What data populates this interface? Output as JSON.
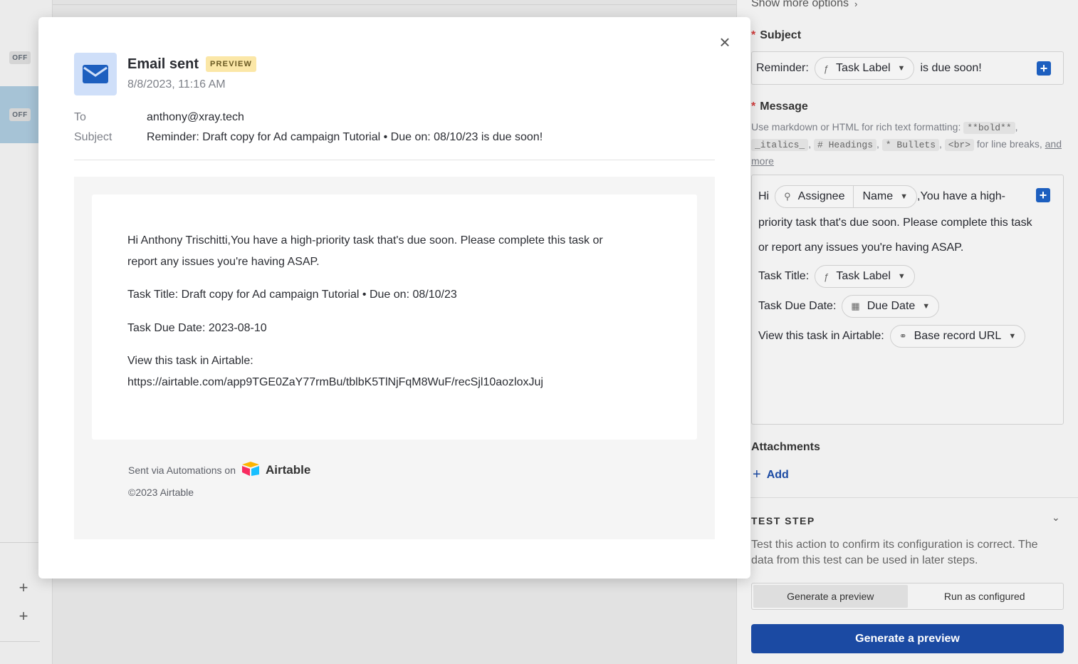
{
  "left_strip": {
    "off_label": "OFF",
    "plus_glyph": "+"
  },
  "modal": {
    "close_glyph": "×",
    "title": "Email sent",
    "badge": "PREVIEW",
    "timestamp": "8/8/2023, 11:16 AM",
    "to_label": "To",
    "to_value": "anthony@xray.tech",
    "subject_label": "Subject",
    "subject_value": "Reminder: Draft copy for Ad campaign Tutorial • Due on: 08/10/23 is due soon!",
    "body": {
      "line1": "Hi Anthony Trischitti,You have a high-priority task that's due soon. Please complete this task or",
      "line2": "report any issues you're having ASAP.",
      "task_title": "Task Title: Draft copy for Ad campaign Tutorial • Due on: 08/10/23",
      "due_date": "Task Due Date: 2023-08-10",
      "view_label": "View this task in Airtable:",
      "url": "https://airtable.com/app9TGE0ZaY77rmBu/tblbK5TlNjFqM8WuF/recSjl10aozloxJuj"
    },
    "footer": {
      "sent_via": "Sent via Automations on",
      "brand": "Airtable",
      "copyright": "©2023 Airtable"
    }
  },
  "right_panel": {
    "show_more": "Show more options",
    "subject_label": "Subject",
    "subject": {
      "prefix": "Reminder:",
      "token": "Task Label",
      "suffix": "is due soon!"
    },
    "message_label": "Message",
    "hint": {
      "text1": "Use markdown or HTML for rich text formatting:",
      "bold": "**bold**",
      "italics": "_italics_",
      "headings": "# Headings",
      "bullets": "* Bullets",
      "br": "<br>",
      "text2": "for line breaks,",
      "link1": "and",
      "link2": "more"
    },
    "message": {
      "hi": "Hi",
      "token_field": "Assignee",
      "token_sub": "Name",
      "line1_suffix": ",You have a high-",
      "line2": "priority task that's due soon. Please complete this task",
      "line3": "or report any issues you're having ASAP.",
      "task_title_label": "Task Title:",
      "task_title_token": "Task Label",
      "due_label": "Task Due Date:",
      "due_token": "Due Date",
      "view_label": "View this task in Airtable:",
      "view_token": "Base record URL"
    },
    "attachments_label": "Attachments",
    "add_label": "Add",
    "test_step_label": "TEST STEP",
    "test_step_desc_1": "Test this action to confirm its configuration is correct. The",
    "test_step_desc_2": "data from this test can be used in later steps.",
    "seg_option_1": "Generate a preview",
    "seg_option_2": "Run as configured",
    "primary_button": "Generate a preview"
  },
  "colors": {
    "primary": "#1b4aa3",
    "badge_bg": "#fbe7a7",
    "plus_blue": "#1d5fbf"
  }
}
